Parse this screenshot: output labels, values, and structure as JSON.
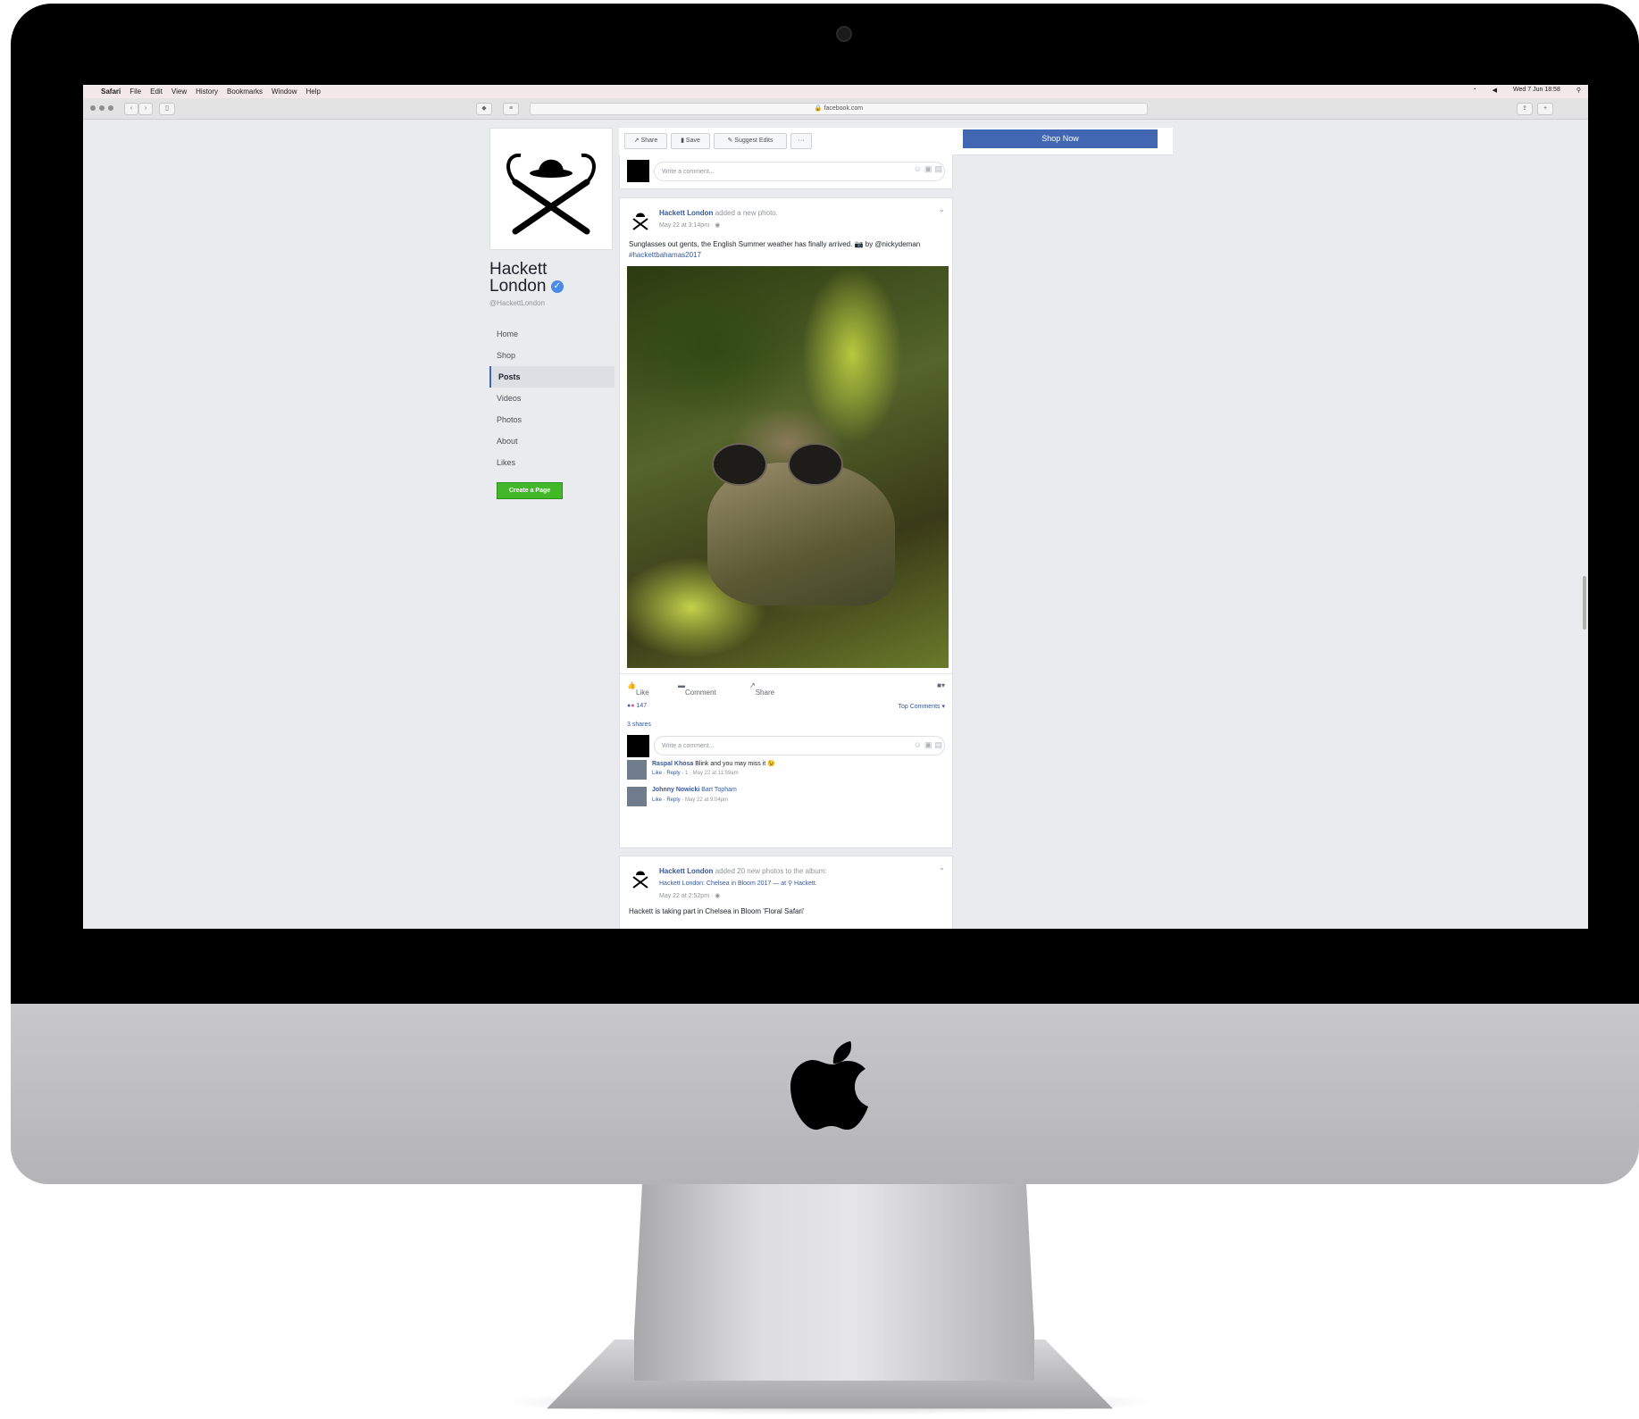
{
  "menubar": {
    "items": [
      "Safari",
      "File",
      "Edit",
      "View",
      "History",
      "Bookmarks",
      "Window",
      "Help"
    ],
    "clock": "Wed 7 Jun 18:58"
  },
  "browser": {
    "url": "facebook.com"
  },
  "page": {
    "name_line1": "Hackett",
    "name_line2": "London",
    "handle": "@HackettLondon",
    "nav": [
      "Home",
      "Shop",
      "Posts",
      "Videos",
      "Photos",
      "About",
      "Likes"
    ],
    "active_nav": "Posts",
    "create_page": "Create a Page"
  },
  "actions": {
    "share": "Share",
    "save": "Save",
    "suggest": "Suggest Edits",
    "more": "···",
    "shop_now": "Shop Now"
  },
  "comment_box": {
    "placeholder": "Write a comment..."
  },
  "post1": {
    "author": "Hackett London",
    "verb": "added a new photo.",
    "meta": "May 22 at 3:14pm · ◉",
    "text": "Sunglasses out gents, the English Summer weather has finally arrived. 📷 by @nickydeman",
    "hashtag": "#hackettbahamas2017",
    "like": "Like",
    "comment": "Comment",
    "share": "Share",
    "reaction_count": "147",
    "top_comments": "Top Comments ▾",
    "shares": "3 shares",
    "comments": [
      {
        "name": "Raspal Khosa",
        "text": "Blink and you may miss it 😉",
        "sub": "Like · Reply · ",
        "time": "1 · May 22 at 11:59am"
      },
      {
        "name": "Johnny Nowicki",
        "text": "Bart Topham",
        "sub": "Like · Reply · ",
        "time": "May 22 at 9:04pm"
      }
    ]
  },
  "post2": {
    "author": "Hackett London",
    "verb": "added 20 new photos to the album:",
    "album": "Hackett London: Chelsea in Bloom 2017 — at ⚲ Hackett.",
    "meta": "May 22 at 2:52pm · ◉",
    "text": "Hackett is taking part in Chelsea in Bloom 'Floral Safari'"
  },
  "colors": {
    "facebook_blue": "#4267b2",
    "link_blue": "#365899",
    "create_green": "#42b72a",
    "background": "#e9ebee"
  }
}
